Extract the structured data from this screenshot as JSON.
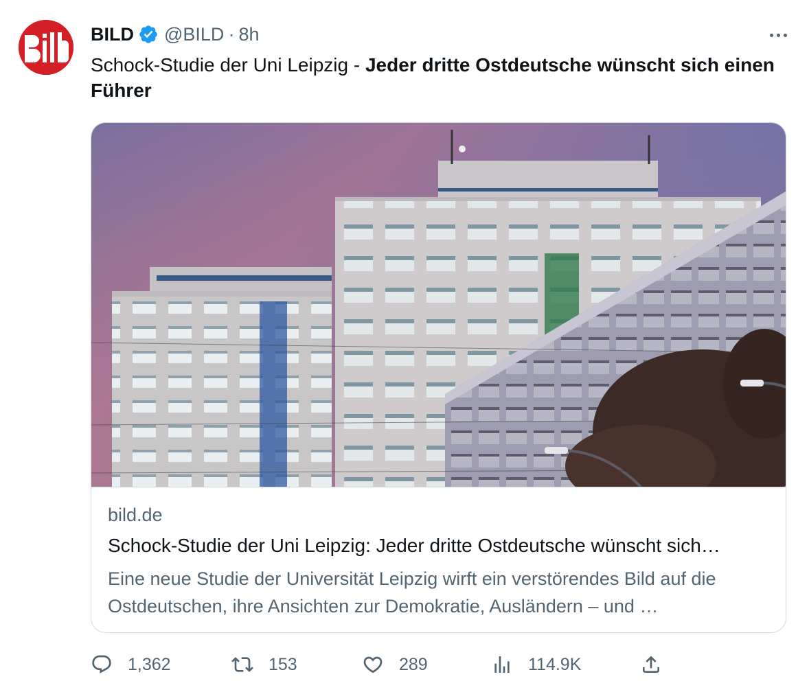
{
  "account": {
    "display_name": "BILD",
    "handle": "@BILD",
    "separator": "·",
    "time": "8h",
    "avatar_text": "Bild"
  },
  "tweet": {
    "text_plain": "Schock-Studie der Uni Leipzig - ",
    "text_bold": "Jeder dritte Ostdeutsche wünscht sich einen Führer"
  },
  "card": {
    "domain": "bild.de",
    "title": "Schock-Studie der Uni Leipzig: Jeder dritte Ostdeutsche wünscht sich…",
    "description": "Eine neue Studie der Universität Leipzig wirft ein verstörendes Bild auf die Ostdeutschen, ihre Ansichten zur Demokratie, Ausländern – und …"
  },
  "actions": {
    "replies": "1,362",
    "retweets": "153",
    "likes": "289",
    "views": "114.9K"
  },
  "colors": {
    "brand_red": "#d51f26",
    "verified_blue": "#1d9bf0",
    "secondary_text": "#536471"
  }
}
